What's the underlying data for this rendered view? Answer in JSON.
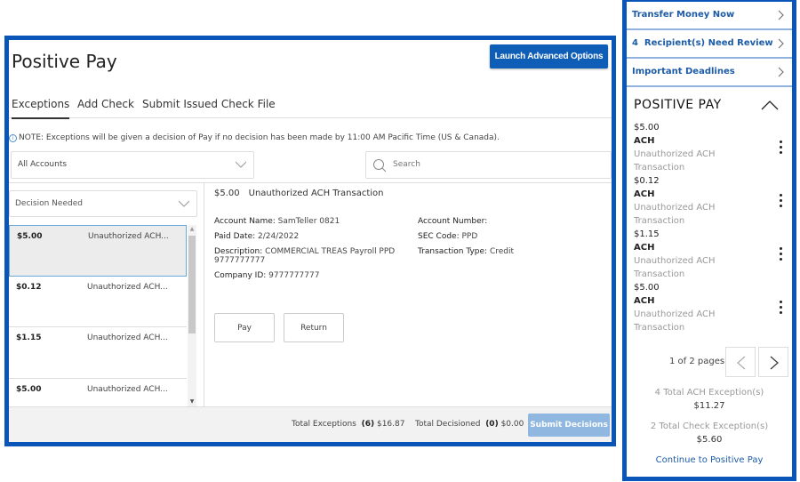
{
  "main": {
    "title": "Positive Pay",
    "launch_button": "Launch Advanced Options",
    "tabs": [
      {
        "label": "Exceptions",
        "active": true
      },
      {
        "label": "Add Check",
        "active": false
      },
      {
        "label": "Submit Issued Check File",
        "active": false
      }
    ],
    "note": "NOTE: Exceptions will be given a decision of Pay if no decision has been made by 11:00 AM Pacific Time (US & Canada).",
    "account_select": "All Accounts",
    "search_placeholder": "Search",
    "decision_select": "Decision Needed",
    "exceptions": [
      {
        "amount": "$5.00",
        "description": "Unauthorized ACH...",
        "selected": true
      },
      {
        "amount": "$0.12",
        "description": "Unauthorized ACH...",
        "selected": false
      },
      {
        "amount": "$1.15",
        "description": "Unauthorized ACH...",
        "selected": false
      },
      {
        "amount": "$5.00",
        "description": "Unauthorized ACH...",
        "selected": false
      }
    ],
    "detail": {
      "amount": "$5.00",
      "title": "Unauthorized ACH Transaction",
      "account_name_label": "Account Name:",
      "account_name": "SamTeller 0821",
      "paid_date_label": "Paid Date:",
      "paid_date": "2/24/2022",
      "description_label": "Description:",
      "description": "COMMERCIAL TREAS Payroll PPD 9777777777",
      "company_id_label": "Company ID:",
      "company_id": "9777777777",
      "account_number_label": "Account Number:",
      "account_number": "",
      "sec_code_label": "SEC Code:",
      "sec_code": "PPD",
      "transaction_type_label": "Transaction Type:",
      "transaction_type": "Credit",
      "pay_button": "Pay",
      "return_button": "Return"
    },
    "footer": {
      "total_exceptions_label": "Total Exceptions",
      "total_exceptions_count": "(6)",
      "total_exceptions_amount": "$16.87",
      "total_decisioned_label": "Total Decisioned",
      "total_decisioned_count": "(0)",
      "total_decisioned_amount": "$0.00",
      "submit_button": "Submit Decisions"
    }
  },
  "sidebar": {
    "links": [
      {
        "label": "Transfer Money Now"
      },
      {
        "label": "4  Recipient(s) Need Review"
      },
      {
        "label": "Important Deadlines"
      }
    ],
    "positive_pay": {
      "title": "POSITIVE PAY",
      "items": [
        {
          "amount": "$5.00",
          "type": "ACH",
          "desc1": "Unauthorized ACH",
          "desc2": "Transaction"
        },
        {
          "amount": "$0.12",
          "type": "ACH",
          "desc1": "Unauthorized ACH",
          "desc2": "Transaction"
        },
        {
          "amount": "$1.15",
          "type": "ACH",
          "desc1": "Unauthorized ACH",
          "desc2": "Transaction"
        },
        {
          "amount": "$5.00",
          "type": "ACH",
          "desc1": "Unauthorized ACH",
          "desc2": "Transaction"
        }
      ],
      "pager_text": "1 of 2 pages",
      "ach_summary_label": "4 Total ACH Exception(s)",
      "ach_summary_amount": "$11.27",
      "check_summary_label": "2 Total Check Exception(s)",
      "check_summary_amount": "$5.60",
      "continue_link": "Continue to Positive Pay"
    }
  },
  "colors": {
    "frame_blue": "#0a55b8",
    "primary_button": "#0e5db7",
    "disabled_button": "#8fb7e0",
    "link_blue": "#1c5ba6"
  }
}
